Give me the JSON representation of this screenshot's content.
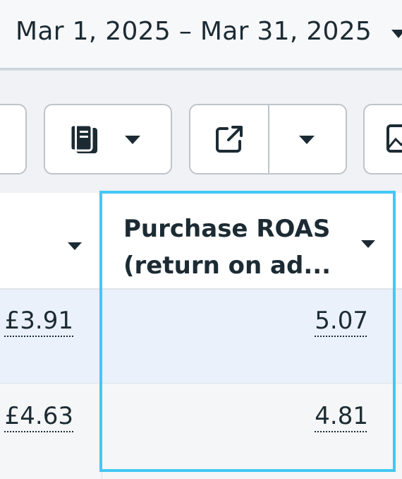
{
  "date_range": {
    "label": "Mar 1, 2025 – Mar 31, 2025"
  },
  "toolbar": {
    "columns_icon": "reports-icon",
    "export_icon": "external-link-icon",
    "media_icon": "image-icon"
  },
  "table": {
    "columns": [
      {
        "id": "prev",
        "header": ""
      },
      {
        "id": "roas",
        "header": "Purchase ROAS (return on ad..."
      }
    ],
    "rows": [
      {
        "prev": "£3.91",
        "roas": "5.07"
      },
      {
        "prev": "£4.63",
        "roas": "4.81"
      }
    ]
  },
  "colors": {
    "highlight": "#42c8f5",
    "selected_row": "#eaf1fb"
  }
}
